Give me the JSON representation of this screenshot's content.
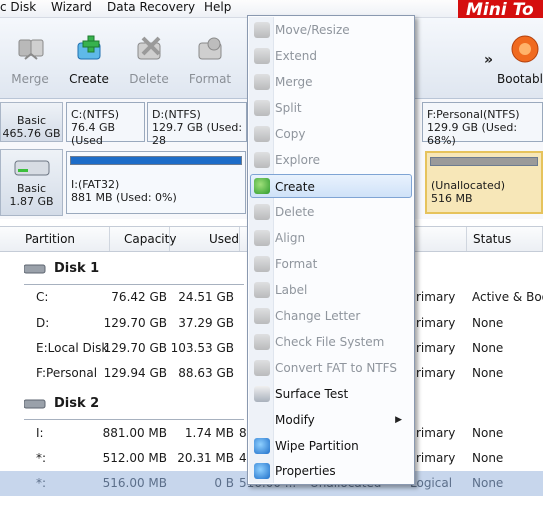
{
  "menubar": {
    "items": [
      "c Disk",
      "Wizard",
      "Data Recovery",
      "Help"
    ],
    "logo_text": "Mini To"
  },
  "toolbar": {
    "buttons": [
      {
        "label": "Merge",
        "icon": "merge-icon",
        "enabled": false
      },
      {
        "label": "Create",
        "icon": "create-icon",
        "enabled": true
      },
      {
        "label": "Delete",
        "icon": "delete-icon",
        "enabled": false
      },
      {
        "label": "Format",
        "icon": "format-icon",
        "enabled": false
      },
      {
        "label": "Bootable",
        "icon": "bootable-icon",
        "enabled": true
      }
    ],
    "more_glyph": "»"
  },
  "diskmap": {
    "disk1": {
      "type": "Basic",
      "size": "465.76 GB",
      "partitions": [
        {
          "name": "C:(NTFS)",
          "info": "76.4 GB (Used"
        },
        {
          "name": "D:(NTFS)",
          "info": "129.7 GB (Used: 28"
        },
        {
          "name": "F:Personal(NTFS)",
          "info": "129.9 GB (Used: 68%)"
        }
      ]
    },
    "disk2": {
      "type": "Basic",
      "size": "1.87 GB",
      "partitions": [
        {
          "name": "I:(FAT32)",
          "info": "881 MB (Used: 0%)"
        },
        {
          "name": "(Unallocated)",
          "info": "516 MB"
        }
      ]
    }
  },
  "table": {
    "headers": [
      "Partition",
      "Capacity",
      "Used",
      "Status"
    ],
    "disk1_label": "Disk 1",
    "disk2_label": "Disk 2",
    "disk1_rows": [
      {
        "partition": "C:",
        "capacity": "76.42 GB",
        "used": "24.51 GB",
        "type": "rimary",
        "status": "Active & Boot &"
      },
      {
        "partition": "D:",
        "capacity": "129.70 GB",
        "used": "37.29 GB",
        "type": "rimary",
        "status": "None"
      },
      {
        "partition": "E:Local Disk",
        "capacity": "129.70 GB",
        "used": "103.53 GB",
        "type": "rimary",
        "status": "None"
      },
      {
        "partition": "F:Personal",
        "capacity": "129.94 GB",
        "used": "88.63 GB",
        "type": "rimary",
        "status": "None"
      }
    ],
    "disk2_rows": [
      {
        "partition": "I:",
        "capacity": "881.00 MB",
        "used": "1.74 MB",
        "extra": "8",
        "type": "rimary",
        "status": "None"
      },
      {
        "partition": "*:",
        "capacity": "512.00 MB",
        "used": "20.31 MB",
        "extra": "4",
        "type": "rimary",
        "status": "None"
      },
      {
        "partition": "*:",
        "capacity": "516.00 MB",
        "used": "0 B",
        "extra": "516.00 ...",
        "fs": "Unallocated",
        "type": "Logical",
        "status": "None"
      }
    ]
  },
  "context_menu": {
    "items": [
      {
        "label": "Move/Resize",
        "icon": "move-resize-icon",
        "enabled": false
      },
      {
        "label": "Extend",
        "icon": "extend-icon",
        "enabled": false
      },
      {
        "label": "Merge",
        "icon": "merge-icon",
        "enabled": false
      },
      {
        "label": "Split",
        "icon": "split-icon",
        "enabled": false
      },
      {
        "label": "Copy",
        "icon": "copy-icon",
        "enabled": false
      },
      {
        "label": "Explore",
        "icon": "explore-icon",
        "enabled": false
      },
      {
        "label": "Create",
        "icon": "create-icon",
        "enabled": true,
        "highlighted": true
      },
      {
        "label": "Delete",
        "icon": "delete-icon",
        "enabled": false
      },
      {
        "label": "Align",
        "icon": "align-icon",
        "enabled": false
      },
      {
        "label": "Format",
        "icon": "format-icon",
        "enabled": false
      },
      {
        "label": "Label",
        "icon": "label-icon",
        "enabled": false
      },
      {
        "label": "Change Letter",
        "icon": "change-letter-icon",
        "enabled": false
      },
      {
        "label": "Check File System",
        "icon": "check-file-system-icon",
        "enabled": false
      },
      {
        "label": "Convert FAT to NTFS",
        "icon": "convert-fat-ntfs-icon",
        "enabled": false
      },
      {
        "label": "Surface Test",
        "icon": "surface-test-icon",
        "enabled": true
      },
      {
        "label": "Modify",
        "icon": "",
        "enabled": true,
        "submenu": true
      },
      {
        "label": "Wipe Partition",
        "icon": "wipe-partition-icon",
        "enabled": true
      },
      {
        "label": "Properties",
        "icon": "properties-icon",
        "enabled": true
      }
    ],
    "submenu_glyph": "▶"
  }
}
